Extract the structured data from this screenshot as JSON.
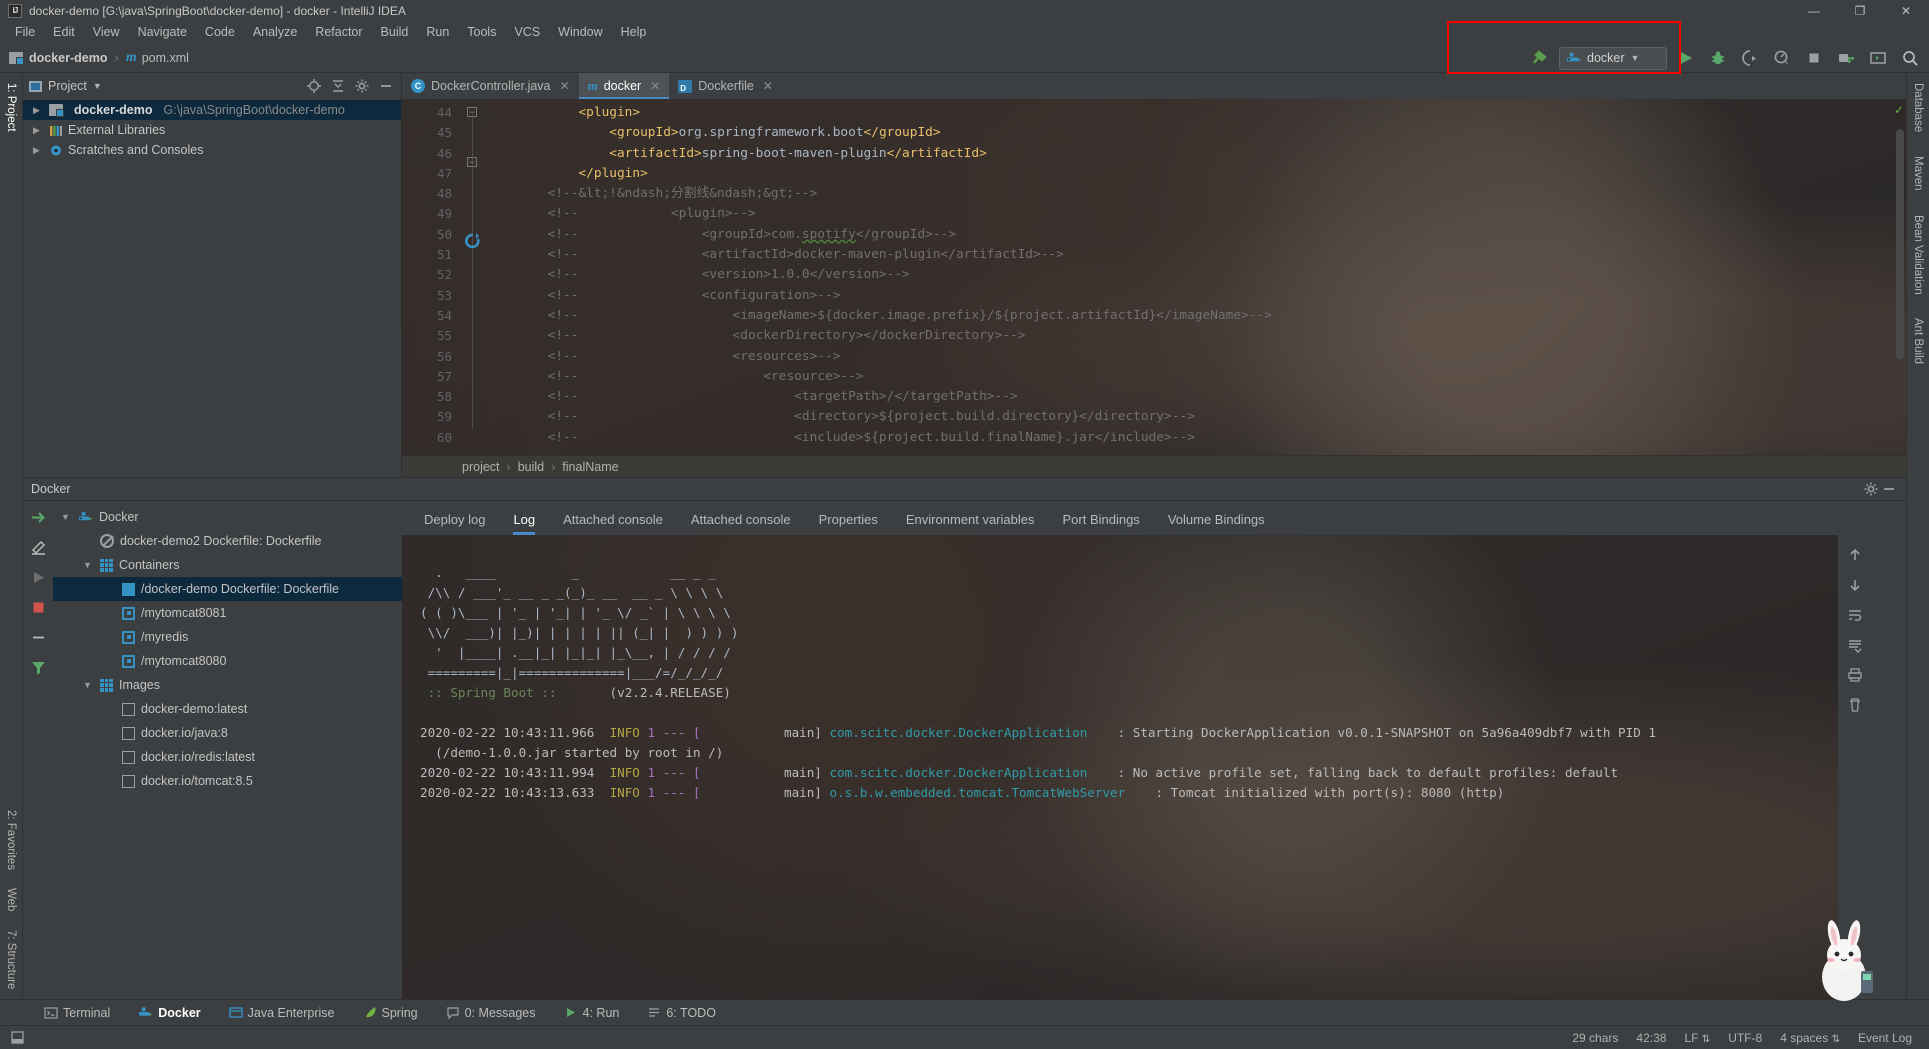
{
  "window": {
    "title": "docker-demo [G:\\java\\SpringBoot\\docker-demo] - docker - IntelliJ IDEA",
    "logo_text": "IJ",
    "minimize": "—",
    "maximize": "❐",
    "close": "✕"
  },
  "menu": {
    "items": [
      "File",
      "Edit",
      "View",
      "Navigate",
      "Code",
      "Analyze",
      "Refactor",
      "Build",
      "Run",
      "Tools",
      "VCS",
      "Window",
      "Help"
    ]
  },
  "navbar": {
    "crumbs": [
      "docker-demo",
      "pom.xml"
    ],
    "separator": "›",
    "module_icon": "module-icon",
    "maven_icon": "maven-m-icon"
  },
  "toolbar": {
    "build_icon": "hammer-icon",
    "run_config": {
      "label": "docker",
      "icon": "docker-whale-icon",
      "chevron": "▼"
    },
    "run_icon": "run-play-icon",
    "debug_icon": "debug-bug-icon",
    "run_coverage_icon": "run-with-coverage-icon",
    "profiler_icon": "profiler-icon",
    "stop_icon": "stop-icon",
    "update_icon": "update-project-icon",
    "terminal_icon": "open-terminal-icon",
    "search_icon": "search-everywhere-icon",
    "highlight_color": "#ff0000"
  },
  "project_panel": {
    "title": "Project",
    "chevron": "▼",
    "locate_icon": "locate-file-icon",
    "collapse_icon": "collapse-all-icon",
    "settings_icon": "gear-icon",
    "hide_icon": "hide-icon",
    "tree": [
      {
        "label": "docker-demo",
        "path": "G:\\java\\SpringBoot\\docker-demo",
        "arrow": "▶",
        "bold": true,
        "selected": true,
        "icon": "module-icon"
      },
      {
        "label": "External Libraries",
        "path": "",
        "arrow": "▶",
        "bold": false,
        "selected": false,
        "icon": "libraries-icon"
      },
      {
        "label": "Scratches and Consoles",
        "path": "",
        "arrow": "▶",
        "bold": false,
        "selected": false,
        "icon": "scratches-icon"
      }
    ]
  },
  "left_strip": {
    "top_tab": "1: Project",
    "bottom_tabs": [
      "2: Favorites",
      "Web",
      "7: Structure"
    ]
  },
  "right_strip": {
    "tabs": [
      "Database",
      "Maven",
      "Bean Validation",
      "Ant Build"
    ]
  },
  "editor": {
    "tabs": [
      {
        "label": "DockerController.java",
        "icon": "java-class-icon",
        "active": false,
        "close": "✕"
      },
      {
        "label": "docker",
        "icon": "maven-m-icon",
        "active": true,
        "close": "✕"
      },
      {
        "label": "Dockerfile",
        "icon": "dockerfile-icon",
        "active": false,
        "close": "✕"
      }
    ],
    "first_line": 44,
    "lines": [
      {
        "n": 44,
        "segments": [
          {
            "t": "            ",
            "c": "txt"
          },
          {
            "t": "<plugin>",
            "c": "tag"
          }
        ]
      },
      {
        "n": 45,
        "segments": [
          {
            "t": "                ",
            "c": "txt"
          },
          {
            "t": "<groupId>",
            "c": "tag"
          },
          {
            "t": "org.springframework.boot",
            "c": "txt"
          },
          {
            "t": "</groupId>",
            "c": "tag"
          }
        ]
      },
      {
        "n": 46,
        "segments": [
          {
            "t": "                ",
            "c": "txt"
          },
          {
            "t": "<artifactId>",
            "c": "tag"
          },
          {
            "t": "spring-boot-maven-plugin",
            "c": "txt"
          },
          {
            "t": "</artifactId>",
            "c": "tag"
          }
        ]
      },
      {
        "n": 47,
        "segments": [
          {
            "t": "            ",
            "c": "txt"
          },
          {
            "t": "</plugin>",
            "c": "tag"
          }
        ]
      },
      {
        "n": 48,
        "segments": [
          {
            "t": "        <!--&lt;!&ndash;分割线&ndash;&gt;-->",
            "c": "cmt"
          }
        ]
      },
      {
        "n": 49,
        "segments": [
          {
            "t": "        <!--            <plugin>-->",
            "c": "cmt"
          }
        ]
      },
      {
        "n": 50,
        "segments": [
          {
            "t": "        <!--                <groupId>com.",
            "c": "cmt"
          },
          {
            "t": "spotify",
            "c": "cmt spell"
          },
          {
            "t": "</groupId>-->",
            "c": "cmt"
          }
        ]
      },
      {
        "n": 51,
        "segments": [
          {
            "t": "        <!--                <artifactId>docker-maven-plugin</artifactId>-->",
            "c": "cmt"
          }
        ]
      },
      {
        "n": 52,
        "segments": [
          {
            "t": "        <!--                <version>1.0.0</version>-->",
            "c": "cmt"
          }
        ]
      },
      {
        "n": 53,
        "segments": [
          {
            "t": "        <!--                <configuration>-->",
            "c": "cmt"
          }
        ]
      },
      {
        "n": 54,
        "segments": [
          {
            "t": "        <!--                    <imageName>${docker.image.prefix}/${project.artifactId}</imageName>-->",
            "c": "cmt"
          }
        ]
      },
      {
        "n": 55,
        "segments": [
          {
            "t": "        <!--                    <dockerDirectory></dockerDirectory>-->",
            "c": "cmt"
          }
        ]
      },
      {
        "n": 56,
        "segments": [
          {
            "t": "        <!--                    <resources>-->",
            "c": "cmt"
          }
        ]
      },
      {
        "n": 57,
        "segments": [
          {
            "t": "        <!--                        <resource>-->",
            "c": "cmt"
          }
        ]
      },
      {
        "n": 58,
        "segments": [
          {
            "t": "        <!--                            <targetPath>/</targetPath>-->",
            "c": "cmt"
          }
        ]
      },
      {
        "n": 59,
        "segments": [
          {
            "t": "        <!--                            <directory>${project.build.directory}</directory>-->",
            "c": "cmt"
          }
        ]
      },
      {
        "n": 60,
        "segments": [
          {
            "t": "        <!--                            <include>${project.build.finalName}.jar</include>-->",
            "c": "cmt"
          }
        ]
      }
    ],
    "breadcrumb": [
      "project",
      "build",
      "finalName"
    ],
    "breadcrumb_separator": "›",
    "inspection_ok_icon": "inspections-ok-icon"
  },
  "docker_panel": {
    "title": "Docker",
    "settings_icon": "gear-icon",
    "hide_icon": "hide-icon",
    "actions": [
      "deploy-icon",
      "edit-icon",
      "run-icon",
      "stop-icon",
      "remove-icon",
      "filter-icon"
    ],
    "tree": [
      {
        "label": "Docker",
        "indent": 0,
        "arrow": "▼",
        "icon": "docker-whale-icon",
        "selected": false
      },
      {
        "label": "docker-demo2 Dockerfile: Dockerfile",
        "indent": 1,
        "arrow": "",
        "icon": "banned-icon",
        "selected": false
      },
      {
        "label": "Containers",
        "indent": 1,
        "arrow": "▼",
        "icon": "containers-grid-icon",
        "selected": false
      },
      {
        "label": "/docker-demo Dockerfile: Dockerfile",
        "indent": 2,
        "arrow": "",
        "icon": "container-running-icon",
        "selected": true
      },
      {
        "label": "/mytomcat8081",
        "indent": 2,
        "arrow": "",
        "icon": "container-stopped-icon",
        "selected": false
      },
      {
        "label": "/myredis",
        "indent": 2,
        "arrow": "",
        "icon": "container-stopped-icon",
        "selected": false
      },
      {
        "label": "/mytomcat8080",
        "indent": 2,
        "arrow": "",
        "icon": "container-stopped-icon",
        "selected": false
      },
      {
        "label": "Images",
        "indent": 1,
        "arrow": "▼",
        "icon": "images-grid-icon",
        "selected": false
      },
      {
        "label": "docker-demo:latest",
        "indent": 2,
        "arrow": "",
        "icon": "image-icon",
        "selected": false
      },
      {
        "label": "docker.io/java:8",
        "indent": 2,
        "arrow": "",
        "icon": "image-icon",
        "selected": false
      },
      {
        "label": "docker.io/redis:latest",
        "indent": 2,
        "arrow": "",
        "icon": "image-icon",
        "selected": false
      },
      {
        "label": "docker.io/tomcat:8.5",
        "indent": 2,
        "arrow": "",
        "icon": "image-icon",
        "selected": false
      }
    ],
    "log_tabs": [
      {
        "label": "Deploy log",
        "active": false
      },
      {
        "label": "Log",
        "active": true
      },
      {
        "label": "Attached console",
        "active": false
      },
      {
        "label": "Attached console",
        "active": false
      },
      {
        "label": "Properties",
        "active": false
      },
      {
        "label": "Environment variables",
        "active": false
      },
      {
        "label": "Port Bindings",
        "active": false
      },
      {
        "label": "Volume Bindings",
        "active": false
      }
    ],
    "console_side_icons": [
      "scroll-up-icon",
      "scroll-down-icon",
      "soft-wrap-icon",
      "scroll-to-end-icon",
      "print-icon",
      "delete-icon"
    ],
    "banner": [
      "  .   ____          _            __ _ _",
      " /\\\\ / ___'_ __ _ _(_)_ __  __ _ \\ \\ \\ \\",
      "( ( )\\___ | '_ | '_| | '_ \\/ _` | \\ \\ \\ \\",
      " \\\\/  ___)| |_)| | | | | || (_| |  ) ) ) )",
      "  '  |____| .__|_| |_|_| |_\\__, | / / / /",
      " =========|_|==============|___/=/_/_/_/"
    ],
    "banner_version_line": " :: Spring Boot ::        (v2.2.4.RELEASE)",
    "banner_version_label": " :: Spring Boot ::",
    "banner_version_value": "       (v2.2.4.RELEASE)",
    "log_lines": [
      {
        "time": "2020-02-22 10:43:11.966",
        "level": "INFO",
        "pid": "1 --- [",
        "thread": "           main]",
        "logger": "com.scitc.docker.DockerApplication",
        "msg": ": Starting DockerApplication v0.0.1-SNAPSHOT on 5a96a409dbf7 with PID 1"
      },
      {
        "time": "",
        "level": "",
        "pid": "",
        "thread": "",
        "logger": "",
        "msg": "  (/demo-1.0.0.jar started by root in /)"
      },
      {
        "time": "2020-02-22 10:43:11.994",
        "level": "INFO",
        "pid": "1 --- [",
        "thread": "           main]",
        "logger": "com.scitc.docker.DockerApplication",
        "msg": ": No active profile set, falling back to default profiles: default"
      },
      {
        "time": "2020-02-22 10:43:13.633",
        "level": "INFO",
        "pid": "1 --- [",
        "thread": "           main]",
        "logger": "o.s.b.w.embedded.tomcat.TomcatWebServer",
        "msg": ": Tomcat initialized with port(s): 8080 (http)"
      }
    ]
  },
  "bottom_tabs": [
    {
      "label": "Terminal",
      "icon": "terminal-icon",
      "active": false
    },
    {
      "label": "Docker",
      "icon": "docker-whale-icon",
      "active": true
    },
    {
      "label": "Java Enterprise",
      "icon": "java-enterprise-icon",
      "active": false
    },
    {
      "label": "Spring",
      "icon": "spring-leaf-icon",
      "active": false
    },
    {
      "label": "0: Messages",
      "icon": "messages-icon",
      "active": false
    },
    {
      "label": "4: Run",
      "icon": "run-play-icon",
      "active": false
    },
    {
      "label": "6: TODO",
      "icon": "todo-icon",
      "active": false
    }
  ],
  "statusbar": {
    "left_icon": "toggle-toolbar-icon",
    "chars": "29 chars",
    "caret": "42:38",
    "line_sep": "LF",
    "encoding": "UTF-8",
    "indent": "4 spaces",
    "event_log": "Event Log",
    "arrow": "⇅"
  }
}
